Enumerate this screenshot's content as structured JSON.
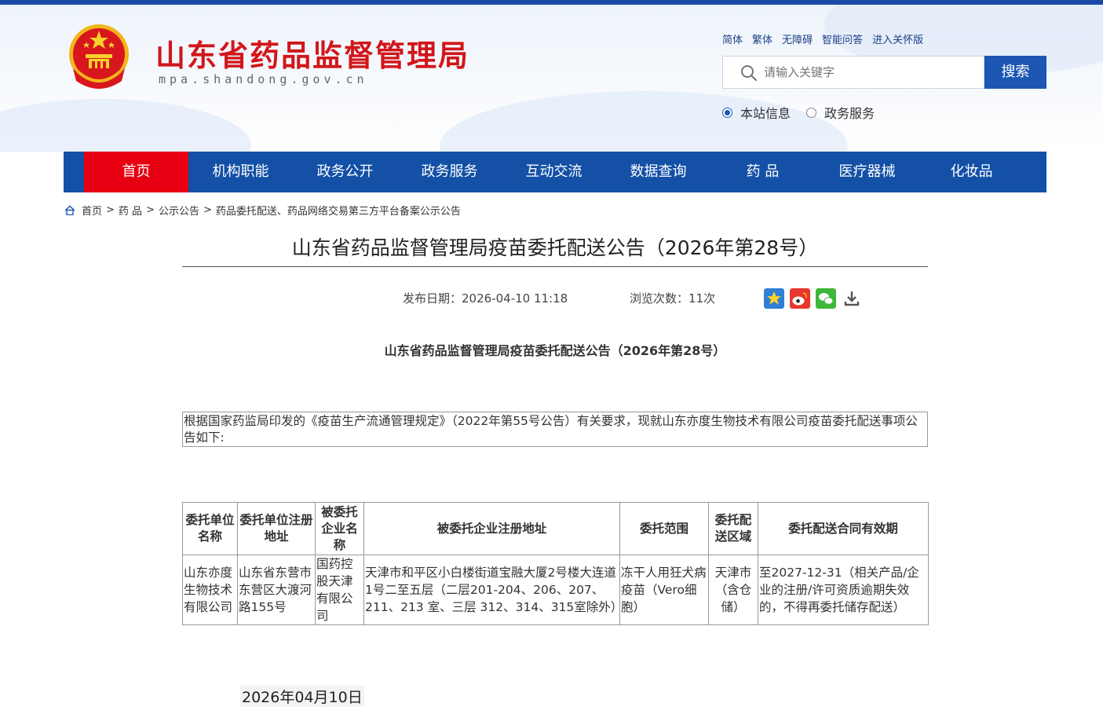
{
  "header": {
    "site_title": "山东省药品监督管理局",
    "site_domain": "mpa.shandong.gov.cn",
    "top_links": [
      "简体",
      "繁体",
      "无障碍",
      "智能问答",
      "进入关怀版"
    ],
    "search": {
      "placeholder": "请输入关键字",
      "button_label": "搜索"
    },
    "scope": {
      "options": [
        "本站信息",
        "政务服务"
      ],
      "selected": "本站信息"
    }
  },
  "nav": {
    "items": [
      "首页",
      "机构职能",
      "政务公开",
      "政务服务",
      "互动交流",
      "数据查询",
      "药 品",
      "医疗器械",
      "化妆品"
    ],
    "active": "首页"
  },
  "breadcrumb": [
    "首页",
    "药 品",
    "公示公告",
    "药品委托配送、药品网络交易第三方平台备案公示公告"
  ],
  "article": {
    "title": "山东省药品监督管理局疫苗委托配送公告（2026年第28号）",
    "publish_label": "发布日期：",
    "publish_date": "2026-04-10 11:18",
    "views_label": "浏览次数：",
    "views": "11次",
    "share_icons": [
      "favorite-icon",
      "weibo-icon",
      "wechat-icon",
      "download-icon"
    ],
    "sub_title": "山东省药品监督管理局疫苗委托配送公告（2026年第28号）",
    "intro": "根据国家药监局印发的《疫苗生产流通管理规定》（2022年第55号公告）有关要求，现就山东亦度生物技术有限公司疫苗委托配送事项公告如下:",
    "table": {
      "headers": [
        "委托单位名称",
        "委托单位注册地址",
        "被委托企业名称",
        "被委托企业注册地址",
        "委托范围",
        "委托配送区域",
        "委托配送合同有效期"
      ],
      "rows": [
        [
          "山东亦度生物技术有限公司",
          "山东省东营市东营区大渡河路155号",
          "国药控股天津有限公司",
          "天津市和平区小白楼街道宝融大厦2号楼大连道1号二至五层（二层201-204、206、207、211、213 室、三层 312、314、315室除外）",
          "冻干人用狂犬病疫苗（Vero细胞）",
          "天津市（含仓储）",
          "至2027-12-31（相关产品/企业的注册/许可资质逾期失效的，不得再委托储存配送）"
        ]
      ]
    },
    "sign_date": "2026年04月10日"
  },
  "colors": {
    "brand_blue": "#1350a6",
    "active_red": "#e60012",
    "title_red": "#d1161b"
  }
}
